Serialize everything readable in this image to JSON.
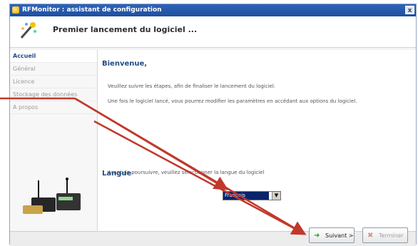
{
  "window": {
    "title": "RFMonitor : assistant de configuration",
    "close_label": "x"
  },
  "header": {
    "heading": "Premier lancement du logiciel ..."
  },
  "sidebar": {
    "items": [
      {
        "label": "Accueil"
      },
      {
        "label": "Général"
      },
      {
        "label": "Licence"
      },
      {
        "label": "Stockage des données"
      },
      {
        "label": "A propos"
      }
    ]
  },
  "main": {
    "welcome_title": "Bienvenue,",
    "welcome_line1": "Veuillez suivre les étapes, afin de finaliser le lancement du logiciel.",
    "welcome_line2": "Une fois le logiciel lancé, vous pourrez modifier les paramètres en accédant aux options du logiciel.",
    "language_title": "Langue",
    "language_text": "Avant de poursuivre, veuillez sélectionner la langue du logiciel",
    "language_select_value": "Français"
  },
  "footer": {
    "next_label": "Suivant >",
    "finish_label": "Terminer"
  },
  "colors": {
    "annotation_arrow": "#c0392b",
    "accent": "#1f4b86"
  }
}
